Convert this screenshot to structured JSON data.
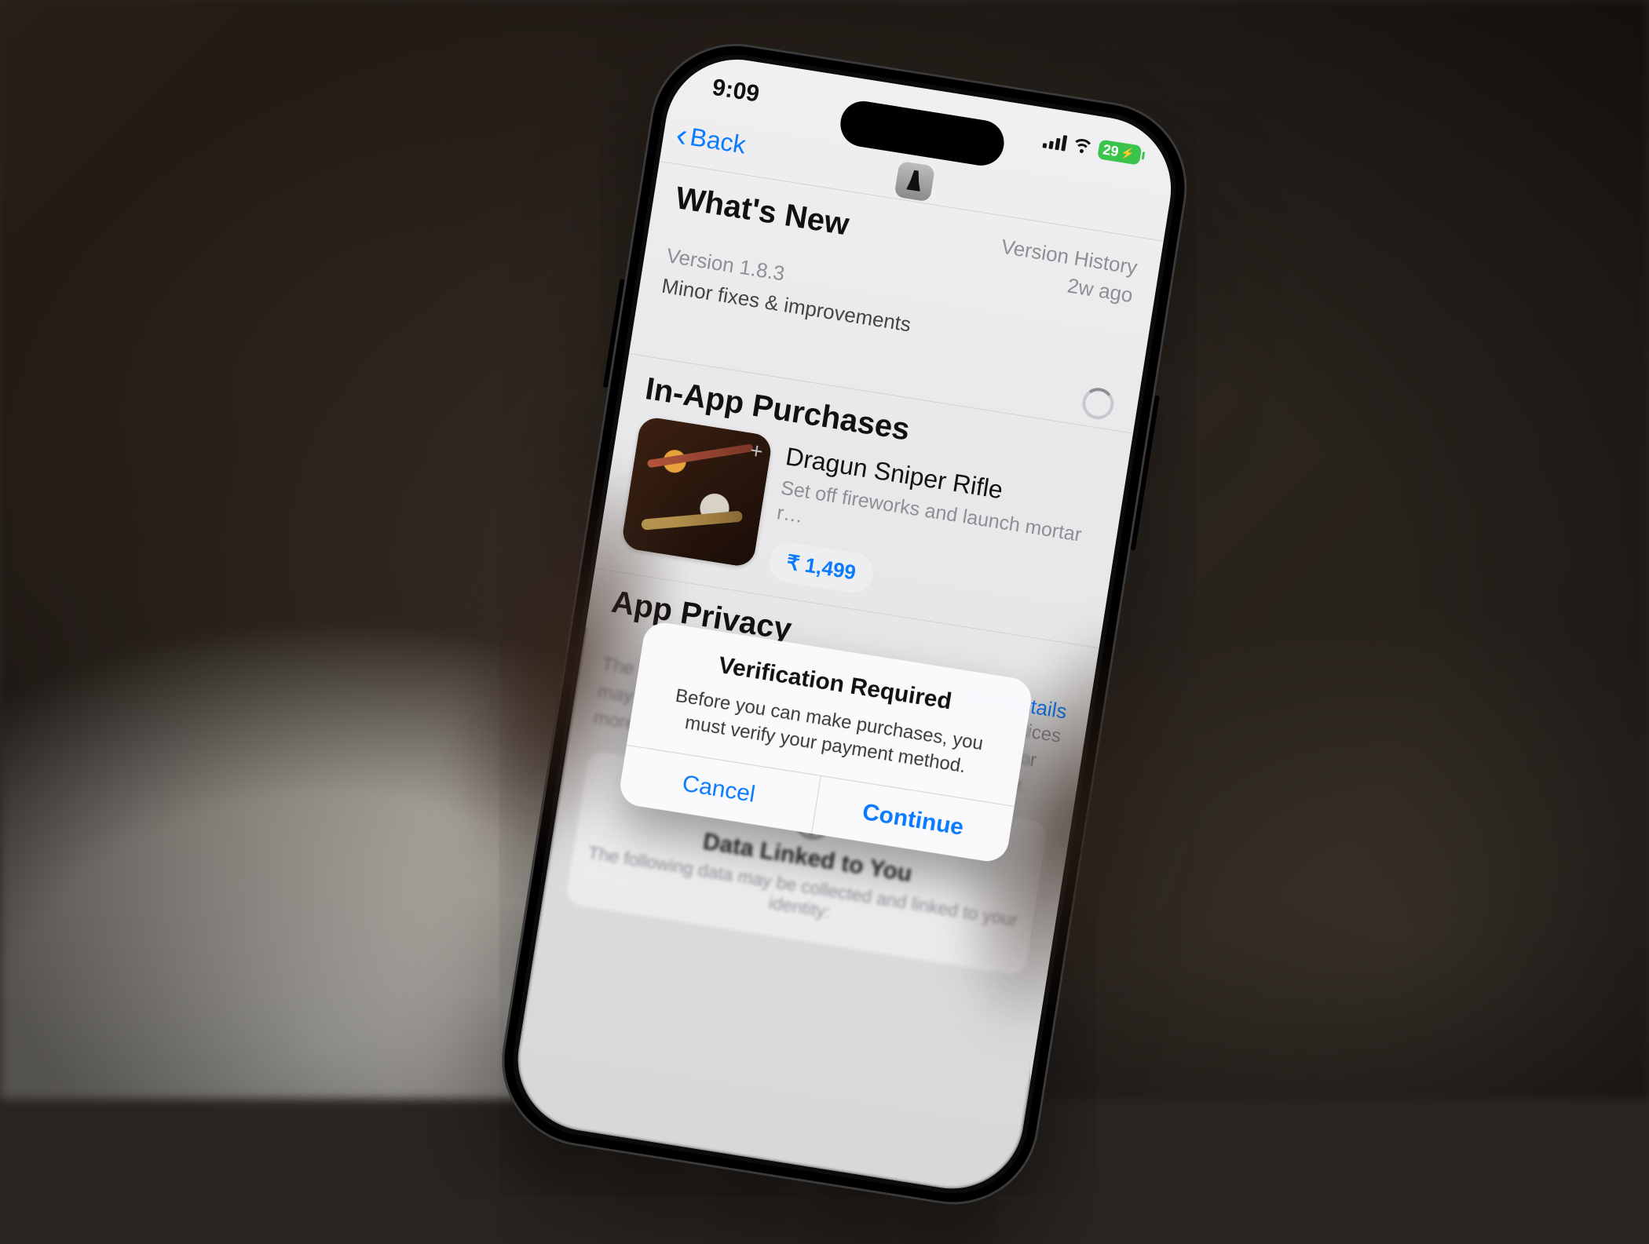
{
  "status_bar": {
    "time": "9:09",
    "battery_percent": "29",
    "battery_charging_symbol": "⚡"
  },
  "nav": {
    "back_label": "Back"
  },
  "whats_new": {
    "title": "What's New",
    "version_label": "Version 1.8.3",
    "description": "Minor fixes & improvements",
    "history_label": "Version History",
    "age_label": "2w ago"
  },
  "iap": {
    "section_title": "In-App Purchases",
    "item": {
      "name": "Dragun Sniper Rifle",
      "description": "Set off fireworks and launch mortar r…",
      "price": "₹ 1,499"
    }
  },
  "privacy": {
    "title": "App Privacy",
    "body_visible": "The developer indicated that the app's privacy practices may include handling of data as described below. For more information, see the developer's privacy policy.",
    "see_details_label": "See Details",
    "linked_card_title": "Data Linked to You",
    "linked_card_body": "The following data may be collected and linked to your identity:"
  },
  "alert": {
    "title": "Verification Required",
    "message": "Before you can make purchases, you must verify your payment method.",
    "cancel_label": "Cancel",
    "continue_label": "Continue"
  }
}
